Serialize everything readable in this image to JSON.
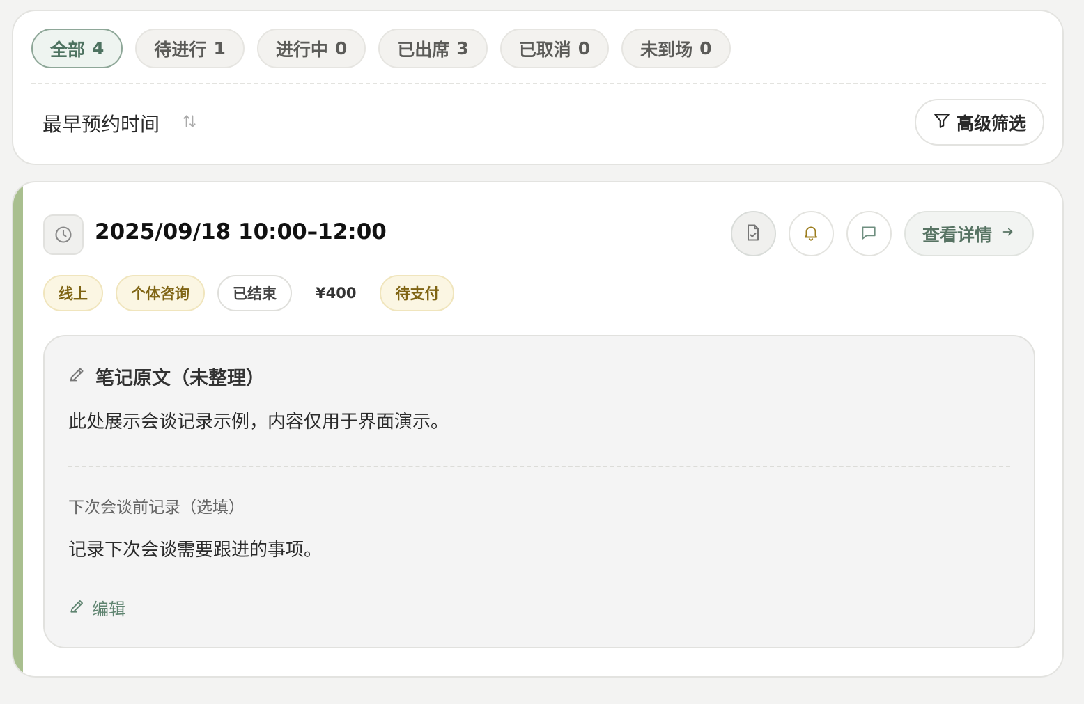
{
  "filter": {
    "tabs": [
      {
        "label": "全部",
        "count": "4",
        "active": true
      },
      {
        "label": "待进行",
        "count": "1"
      },
      {
        "label": "进行中",
        "count": "0"
      },
      {
        "label": "已出席",
        "count": "3"
      },
      {
        "label": "已取消",
        "count": "0"
      },
      {
        "label": "未到场",
        "count": "0"
      }
    ],
    "sort_label": "最早预约时间",
    "advanced_filter_label": "高级筛选"
  },
  "appointment": {
    "time_range": "2025/09/18 10:00–12:00",
    "view_detail_label": "查看详情",
    "tags": {
      "mode": "线上",
      "type": "个体咨询",
      "status": "已结束",
      "price": "¥400",
      "payment": "待支付"
    },
    "notes": {
      "title": "笔记原文（未整理）",
      "body": "此处展示会谈记录示例，内容仅用于界面演示。",
      "next_label": "下次会谈前记录（选填）",
      "next_body": "记录下次会谈需要跟进的事项。",
      "edit_label": "编辑"
    }
  },
  "colors": {
    "accent_green": "#a9bf8f",
    "active_tab_text": "#4d7260",
    "warm_tag_text": "#7f6413",
    "link_green": "#5f8470"
  },
  "icons": [
    "sort-icon",
    "filter-icon",
    "clock-icon",
    "document-icon",
    "bell-icon",
    "message-icon",
    "arrow-right-icon",
    "pencil-icon"
  ]
}
